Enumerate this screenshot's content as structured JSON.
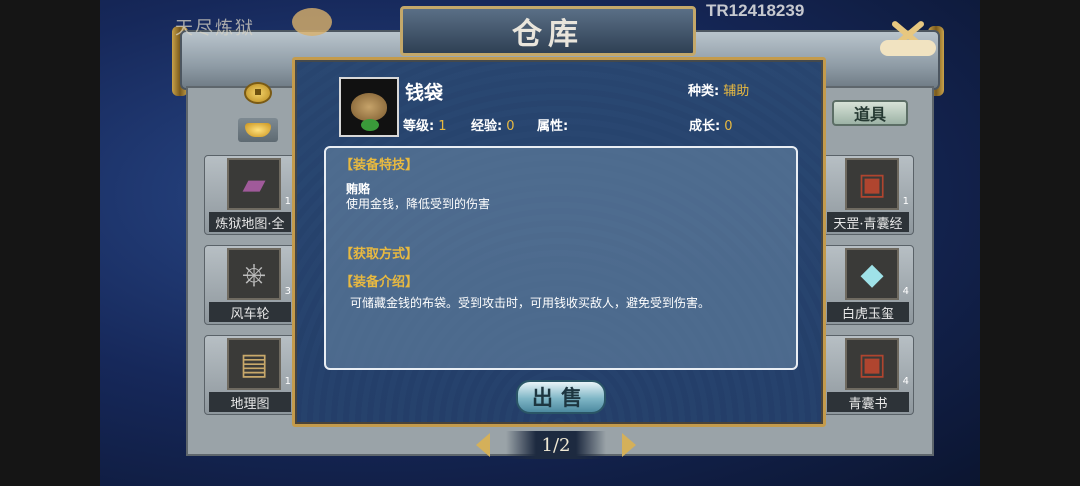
{
  "header": {
    "game_title": "天尽炼狱",
    "window_title": "仓库",
    "tr_code": "TR12418239"
  },
  "tab": {
    "label": "道具"
  },
  "left_items": [
    {
      "name": "炼狱地图·全",
      "count": "1",
      "icon": "map-scroll-icon"
    },
    {
      "name": "风车轮",
      "count": "3",
      "icon": "windmill-wheel-icon"
    },
    {
      "name": "地理图",
      "count": "1",
      "icon": "geography-map-icon"
    }
  ],
  "right_items": [
    {
      "name": "天罡·青囊经",
      "count": "1",
      "icon": "book-icon"
    },
    {
      "name": "白虎玉玺",
      "count": "4",
      "icon": "jade-seal-icon"
    },
    {
      "name": "青囊书",
      "count": "4",
      "icon": "book-icon"
    }
  ],
  "detail": {
    "name": "钱袋",
    "icon": "money-bag-icon",
    "kind_label": "种类:",
    "kind_value": "辅助",
    "level_label": "等级:",
    "level_value": "1",
    "exp_label": "经验:",
    "exp_value": "0",
    "attr_label": "属性:",
    "growth_label": "成长:",
    "growth_value": "0",
    "skill_header": "【装备特技】",
    "skill_name": "贿赂",
    "skill_desc": "使用金钱，降低受到的伤害",
    "obtain_header": "【获取方式】",
    "intro_header": "【装备介绍】",
    "intro_text": "可储藏金钱的布袋。受到攻击时，可用钱收买敌人，避免受到伤害。",
    "sell_label": "出售"
  },
  "pager": {
    "text": "1/2"
  },
  "colors": {
    "accent_gold": "#e8b940",
    "dialog_border": "#c49b4c"
  }
}
